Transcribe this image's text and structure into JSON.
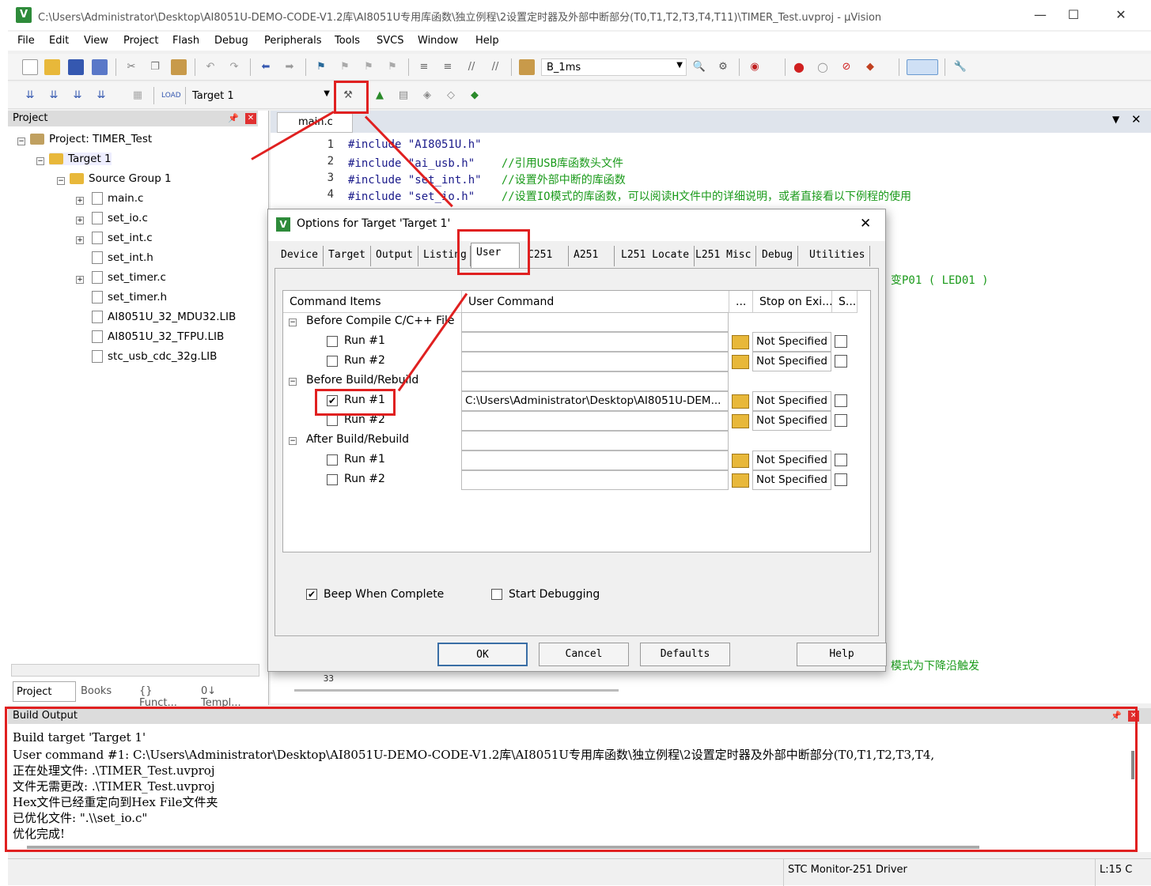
{
  "window": {
    "title": "C:\\Users\\Administrator\\Desktop\\AI8051U-DEMO-CODE-V1.2库\\AI8051U专用库函数\\独立例程\\2设置定时器及外部中断部分(T0,T1,T2,T3,T4,T11)\\TIMER_Test.uvproj - µVision",
    "app_icon": "V"
  },
  "menu": [
    "File",
    "Edit",
    "View",
    "Project",
    "Flash",
    "Debug",
    "Peripherals",
    "Tools",
    "SVCS",
    "Window",
    "Help"
  ],
  "toolbar": {
    "find_combo": "B_1ms",
    "target_combo": "Target 1"
  },
  "project_panel": {
    "header": "Project",
    "tree": [
      {
        "label": "Project: TIMER_Test"
      },
      {
        "label": "Target 1"
      },
      {
        "label": "Source Group 1"
      },
      {
        "label": "main.c"
      },
      {
        "label": "set_io.c"
      },
      {
        "label": "set_int.c"
      },
      {
        "label": "set_int.h"
      },
      {
        "label": "set_timer.c"
      },
      {
        "label": "set_timer.h"
      },
      {
        "label": "AI8051U_32_MDU32.LIB"
      },
      {
        "label": "AI8051U_32_TFPU.LIB"
      },
      {
        "label": "stc_usb_cdc_32g.LIB"
      }
    ],
    "tabs": [
      "Project",
      "Books",
      "{} Funct...",
      "0↓ Templ..."
    ]
  },
  "editor": {
    "tab": "main.c",
    "lines": [
      {
        "n": "1",
        "code": "#include \"AI8051U.h\"",
        "comment": ""
      },
      {
        "n": "2",
        "code": "#include \"ai_usb.h\"    ",
        "comment": "//引用USB库函数头文件"
      },
      {
        "n": "3",
        "code": "#include \"set_int.h\"   ",
        "comment": "//设置外部中断的库函数"
      },
      {
        "n": "4",
        "code": "#include \"set_io.h\"    ",
        "comment": "//设置IO模式的库函数，可以阅读H文件中的详细说明，或者直接看以下例程的使用"
      }
    ],
    "partial_comment_1": "变P01 ( LED01 )",
    "partial_comment_2": "模式为下降沿触发",
    "partial_line_no": "33"
  },
  "dialog": {
    "title": "Options for Target 'Target 1'",
    "tabs": [
      "Device",
      "Target",
      "Output",
      "Listing",
      "User",
      "C251",
      "A251",
      "L251 Locate",
      "L251 Misc",
      "Debug",
      "Utilities"
    ],
    "columns": [
      "Command Items",
      "User Command",
      "...",
      "Stop on Exi...",
      "S..."
    ],
    "groups": [
      {
        "label": "Before Compile C/C++ File",
        "runs": [
          {
            "label": "Run #1",
            "checked": false,
            "command": "",
            "stop": "Not Specified"
          },
          {
            "label": "Run #2",
            "checked": false,
            "command": "",
            "stop": "Not Specified"
          }
        ]
      },
      {
        "label": "Before Build/Rebuild",
        "runs": [
          {
            "label": "Run #1",
            "checked": true,
            "command": "C:\\Users\\Administrator\\Desktop\\AI8051U-DEM...",
            "stop": "Not Specified"
          },
          {
            "label": "Run #2",
            "checked": false,
            "command": "",
            "stop": "Not Specified"
          }
        ]
      },
      {
        "label": "After Build/Rebuild",
        "runs": [
          {
            "label": "Run #1",
            "checked": false,
            "command": "",
            "stop": "Not Specified"
          },
          {
            "label": "Run #2",
            "checked": false,
            "command": "",
            "stop": "Not Specified"
          }
        ]
      }
    ],
    "beep_label": "Beep When Complete",
    "beep_checked": true,
    "start_debug_label": "Start Debugging",
    "start_debug_checked": false,
    "buttons": {
      "ok": "OK",
      "cancel": "Cancel",
      "defaults": "Defaults",
      "help": "Help"
    }
  },
  "build_output": {
    "header": "Build Output",
    "lines": [
      "Build target 'Target 1'",
      "User command #1: C:\\Users\\Administrator\\Desktop\\AI8051U-DEMO-CODE-V1.2库\\AI8051U专用库函数\\独立例程\\2设置定时器及外部中断部分(T0,T1,T2,T3,T4,",
      "正在处理文件: .\\TIMER_Test.uvproj",
      "文件无需更改: .\\TIMER_Test.uvproj",
      "Hex文件已经重定向到Hex File文件夹",
      "已优化文件: \".\\\\set_io.c\"",
      "优化完成!"
    ]
  },
  "statusbar": {
    "driver": "STC Monitor-251 Driver",
    "position": "L:15 C"
  },
  "colors": {
    "highlight": "#e02020",
    "comment": "#1a9a1a",
    "keyword": "#1a1a8a"
  }
}
